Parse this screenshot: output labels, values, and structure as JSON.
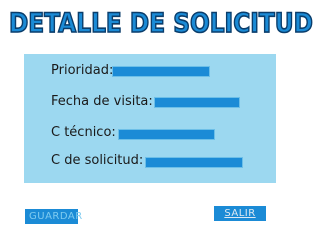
{
  "title": "DETALLE DE SOLICITUD",
  "form": {
    "priority_label": "Prioridad:",
    "visit_date_label": "Fecha de visita:",
    "technician_label": "C técnico:",
    "request_label": "C de solicitud:"
  },
  "buttons": {
    "save": "GUARDAR",
    "exit": "SALIR"
  },
  "colors": {
    "panel": "#9cd8f0",
    "field": "#1b8bd6",
    "title_fill": "#1b8bd6",
    "title_stroke": "#0a3d6b"
  }
}
